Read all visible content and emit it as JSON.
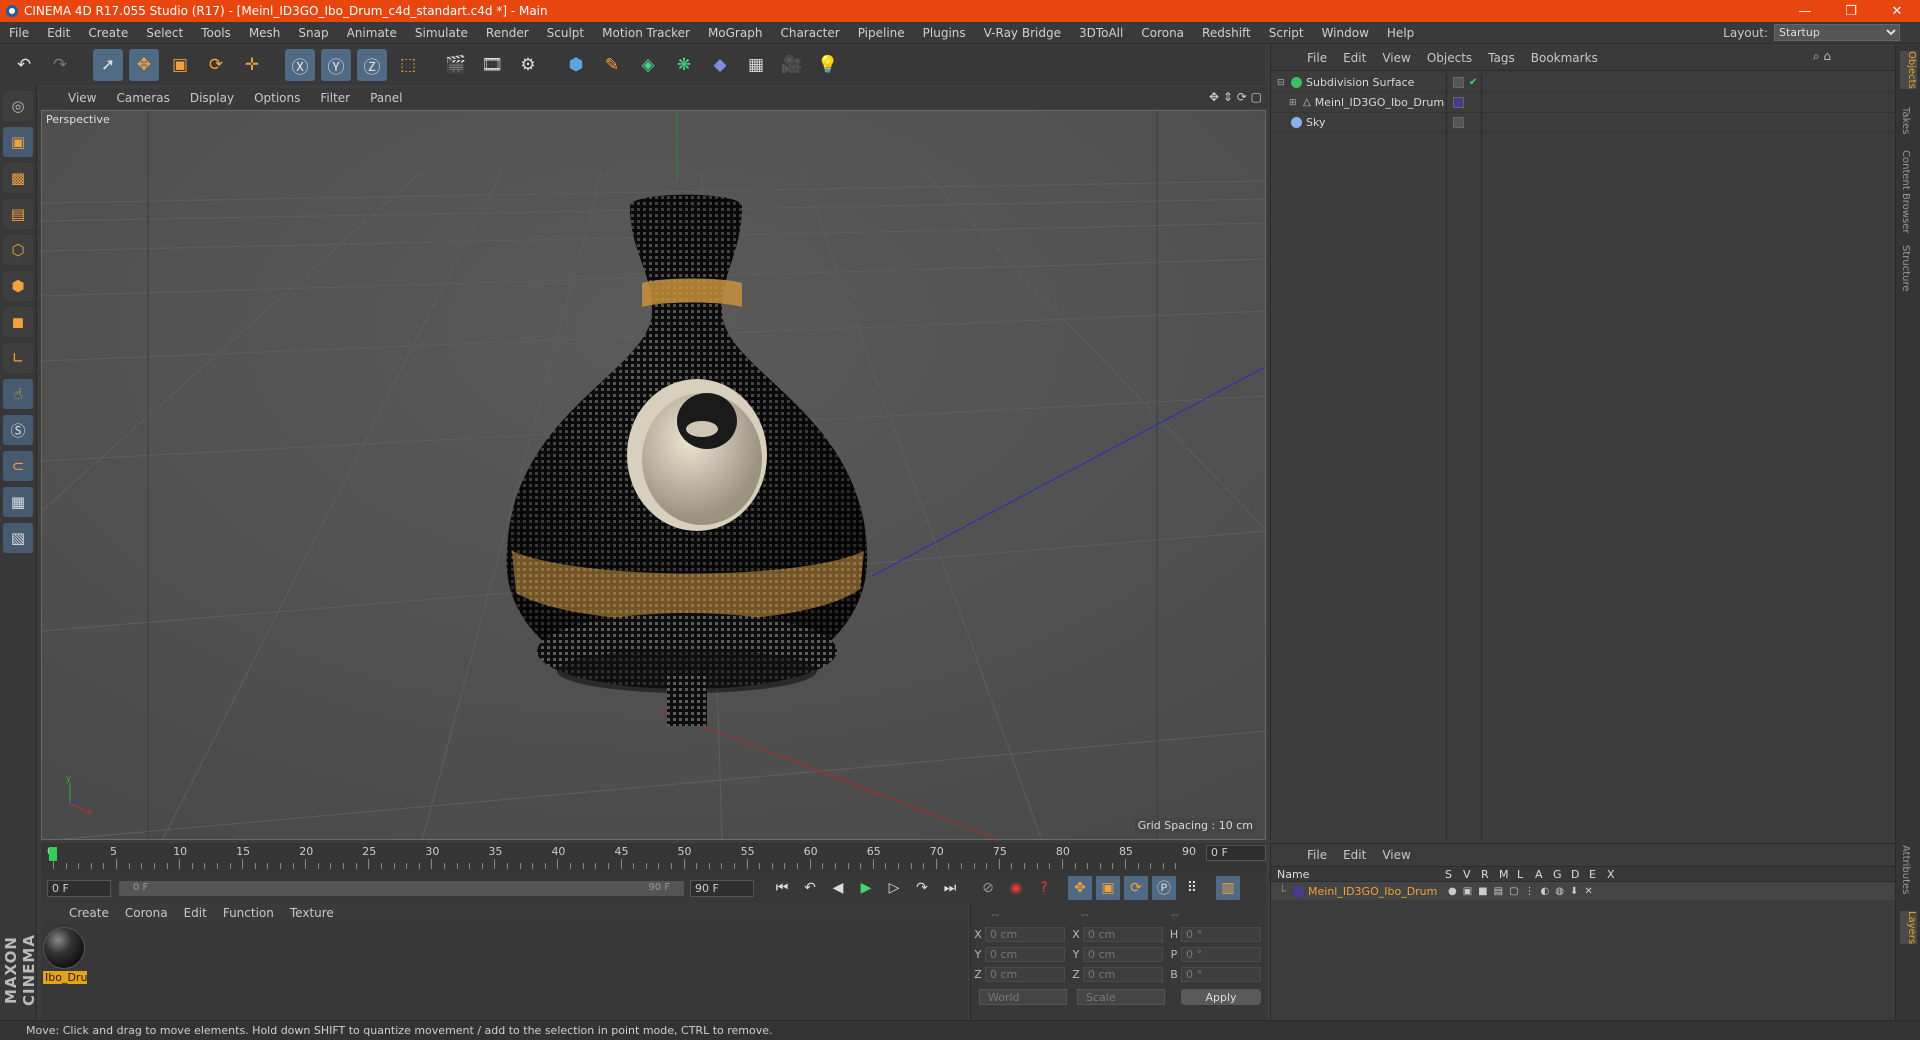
{
  "window": {
    "title": "CINEMA 4D R17.055 Studio (R17) - [Meinl_ID3GO_Ibo_Drum_c4d_standart.c4d *] - Main",
    "controls": [
      "—",
      "❐",
      "✕"
    ]
  },
  "menu": [
    "File",
    "Edit",
    "Create",
    "Select",
    "Tools",
    "Mesh",
    "Snap",
    "Animate",
    "Simulate",
    "Render",
    "Sculpt",
    "Motion Tracker",
    "MoGraph",
    "Character",
    "Pipeline",
    "Plugins",
    "V-Ray Bridge",
    "3DToAll",
    "Corona",
    "Redshift",
    "Script",
    "Window",
    "Help"
  ],
  "layout": {
    "label": "Layout:",
    "value": "Startup"
  },
  "viewport": {
    "menu": [
      "View",
      "Cameras",
      "Display",
      "Options",
      "Filter",
      "Panel"
    ],
    "camera_label": "Perspective",
    "grid_spacing": "Grid Spacing : 10 cm"
  },
  "timeline": {
    "ticks": [
      "0",
      "5",
      "10",
      "15",
      "20",
      "25",
      "30",
      "35",
      "40",
      "45",
      "50",
      "55",
      "60",
      "65",
      "70",
      "75",
      "80",
      "85",
      "90"
    ],
    "current_frame": "0 F",
    "start": "0 F",
    "range_start": "0 F",
    "range_end": "90 F",
    "end": "90 F"
  },
  "material_panel": {
    "menu": [
      "Create",
      "Corona",
      "Edit",
      "Function",
      "Texture"
    ],
    "material_name": "Ibo_Dru"
  },
  "coordinates": {
    "header": [
      "--",
      "--",
      "--"
    ],
    "rows": [
      {
        "a": "X",
        "av": "0 cm",
        "b": "X",
        "bv": "0 cm",
        "c": "H",
        "cv": "0 °"
      },
      {
        "a": "Y",
        "av": "0 cm",
        "b": "Y",
        "bv": "0 cm",
        "c": "P",
        "cv": "0 °"
      },
      {
        "a": "Z",
        "av": "0 cm",
        "b": "Z",
        "bv": "0 cm",
        "c": "B",
        "cv": "0 °"
      }
    ],
    "mode": "World",
    "type": "Scale",
    "apply": "Apply"
  },
  "object_manager": {
    "menu": [
      "File",
      "Edit",
      "View",
      "Objects",
      "Tags",
      "Bookmarks"
    ],
    "objects": [
      {
        "name": "Subdivision Surface",
        "indent": 0
      },
      {
        "name": "Meinl_ID3GO_Ibo_Drum",
        "indent": 1
      },
      {
        "name": "Sky",
        "indent": 0
      }
    ]
  },
  "side_tabs": [
    "Objects",
    "Takes",
    "Content Browser",
    "Structure"
  ],
  "side_tabs_lower": [
    "Attributes",
    "Layers"
  ],
  "layer_manager": {
    "menu": [
      "File",
      "Edit",
      "View"
    ],
    "columns": [
      "Name",
      "S",
      "V",
      "R",
      "M",
      "L",
      "A",
      "G",
      "D",
      "E",
      "X"
    ],
    "row_name": "Meinl_ID3GO_Ibo_Drum"
  },
  "status": "Move: Click and drag to move elements. Hold down SHIFT to quantize movement / add to the selection in point mode, CTRL to remove.",
  "maxon_logo": "MAXON CINEMA 4D"
}
